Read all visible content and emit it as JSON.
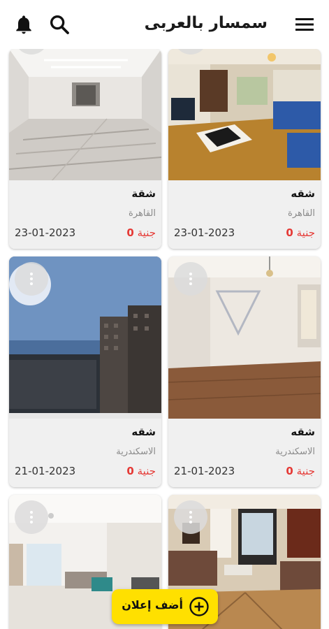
{
  "app": {
    "title": "سمسار بالعربى"
  },
  "icons": {
    "menu": "menu-icon",
    "bell": "bell-icon",
    "search": "search-icon",
    "more": "more-vert-icon",
    "add": "add-circle-icon"
  },
  "colors": {
    "accent": "#ffe000",
    "price": "#e53935"
  },
  "listings": [
    {
      "type": "شقة",
      "city": "القاهرة",
      "price": "0",
      "currency": "جنية",
      "date": "23-01-2023"
    },
    {
      "type": "شقه",
      "city": "القاهرة",
      "price": "0",
      "currency": "جنية",
      "date": "23-01-2023"
    },
    {
      "type": "شقه",
      "city": "الاسكندرية",
      "price": "0",
      "currency": "جنية",
      "date": "21-01-2023"
    },
    {
      "type": "شقه",
      "city": "الاسكندرية",
      "price": "0",
      "currency": "جنية",
      "date": "21-01-2023"
    }
  ],
  "fab": {
    "label": "أضف إعلان"
  }
}
